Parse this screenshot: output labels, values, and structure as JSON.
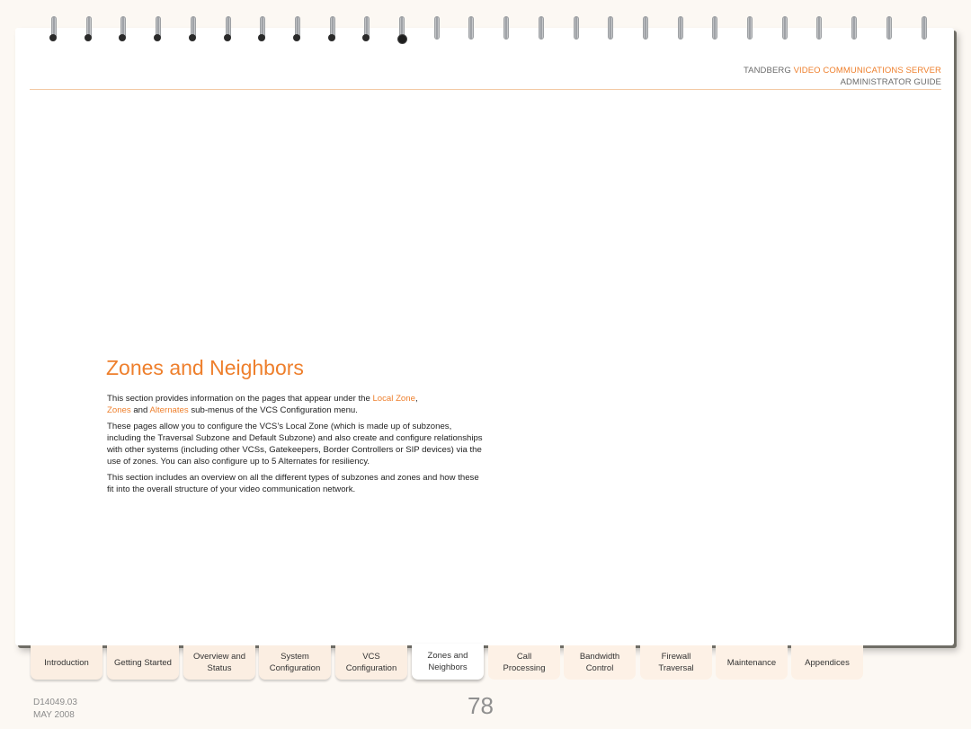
{
  "header": {
    "brand": "TANDBERG",
    "product": "VIDEO COMMUNICATIONS SERVER",
    "guide": "ADMINISTRATOR GUIDE",
    "accent_color": "#ee7f2c"
  },
  "section": {
    "title": "Zones and Neighbors",
    "p1": {
      "before": "This section provides information on the pages that appear under the ",
      "link1": "Local Zone",
      "comma": ",",
      "link2": "Zones",
      "and": " and ",
      "link3": "Alternates",
      "after": " sub-menus of the VCS Configuration menu."
    },
    "p2": "These pages allow you to configure the VCS’s Local Zone (which is made up of subzones, including the Traversal Subzone and Default Subzone) and also create and configure relationships with other systems (including other VCSs, Gatekeepers, Border Controllers or SIP devices) via the use of zones. You can also configure up to 5 Alternates for resiliency.",
    "p3": "This section includes an overview on all the different types of subzones and zones and how these fit into the overall structure of your video communication network."
  },
  "tabs": [
    {
      "line1": "Introduction",
      "line2": ""
    },
    {
      "line1": "Getting Started",
      "line2": ""
    },
    {
      "line1": "Overview and",
      "line2": "Status"
    },
    {
      "line1": "System",
      "line2": "Configuration"
    },
    {
      "line1": "VCS",
      "line2": "Configuration"
    },
    {
      "line1": "Zones and",
      "line2": "Neighbors",
      "active": true
    },
    {
      "line1": "Call",
      "line2": "Processing"
    },
    {
      "line1": "Bandwidth",
      "line2": "Control"
    },
    {
      "line1": "Firewall",
      "line2": "Traversal"
    },
    {
      "line1": "Maintenance",
      "line2": ""
    },
    {
      "line1": "Appendices",
      "line2": ""
    }
  ],
  "footer": {
    "doc_code": "D14049.03",
    "date": "MAY 2008",
    "page_number": "78"
  },
  "binding": {
    "ring_count": 26,
    "rings_with_holes": 11
  }
}
